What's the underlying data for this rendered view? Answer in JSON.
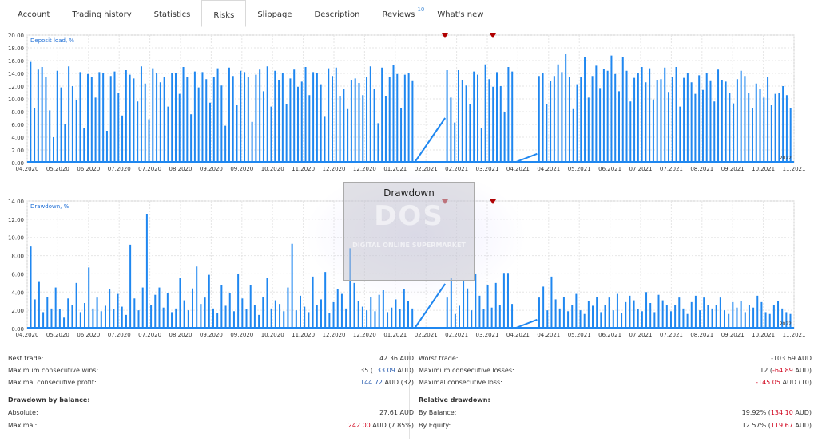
{
  "tabs": [
    {
      "label": "Account",
      "active": false
    },
    {
      "label": "Trading history",
      "active": false
    },
    {
      "label": "Statistics",
      "active": false
    },
    {
      "label": "Risks",
      "active": true
    },
    {
      "label": "Slippage",
      "active": false
    },
    {
      "label": "Description",
      "active": false
    },
    {
      "label": "Reviews",
      "badge": "10",
      "active": false
    },
    {
      "label": "What's new",
      "active": false
    }
  ],
  "x_tick_labels": [
    "04.2020",
    "05.2020",
    "06.2020",
    "07.2020",
    "07.2020",
    "08.2020",
    "09.2020",
    "09.2020",
    "10.2020",
    "11.2020",
    "12.2020",
    "12.2020",
    "01.2021",
    "02.2021",
    "02.2021",
    "03.2021",
    "04.2021",
    "04.2021",
    "05.2021",
    "06.2021",
    "07.2021",
    "07.2021",
    "08.2021",
    "09.2021",
    "10.2021",
    "11.2021"
  ],
  "chart_data": [
    {
      "type": "area",
      "title": "Deposit load, %",
      "ylabel": "",
      "xlabel": "",
      "ylim": [
        0,
        20
      ],
      "y_ticks": [
        "0.00",
        "2.00",
        "4.00",
        "6.00",
        "8.00",
        "10.00",
        "12.00",
        "14.00",
        "16.00",
        "18.00",
        "20.00"
      ],
      "corner_label": "2022",
      "grid": true,
      "color": "#1f87f0",
      "peaks": [
        15.8,
        8.5,
        14.6,
        15.0,
        13.5,
        8.2,
        4.0,
        14.4,
        11.8,
        6.0,
        15.1,
        12.0,
        9.8,
        14.2,
        5.5,
        13.9,
        13.4,
        10.2,
        14.2,
        14.0,
        5.0,
        13.6,
        14.3,
        11.0,
        7.4,
        14.5,
        13.8,
        13.2,
        9.6,
        15.1,
        12.4,
        6.8,
        14.8,
        14.0,
        12.6,
        13.4,
        8.8,
        14.0,
        14.1,
        10.8,
        15.0,
        13.5,
        7.6,
        14.3,
        11.8,
        14.2,
        13.1,
        9.4,
        13.5,
        14.8,
        12.1,
        5.8,
        14.9,
        13.6,
        9.0,
        14.4,
        14.2,
        13.4,
        6.4,
        13.8,
        14.6,
        11.2,
        15.1,
        8.8,
        14.4,
        13.0,
        14.0,
        9.2,
        13.2,
        14.6,
        11.9,
        12.7,
        15.0,
        10.6,
        14.2,
        14.1,
        12.3,
        7.2,
        14.8,
        13.6,
        14.9,
        10.5,
        11.5,
        8.4,
        13.0,
        13.2,
        12.5,
        10.6,
        13.5,
        15.1,
        11.5,
        6.2,
        14.9,
        10.4,
        13.4,
        15.3,
        13.9,
        8.6,
        13.8,
        14.0,
        12.9,
        14.5,
        10.2,
        6.3,
        14.5,
        13.0,
        12.1,
        9.2,
        14.3,
        13.8,
        5.4,
        15.4,
        13.1,
        11.9,
        14.2,
        12.0,
        7.9,
        15.0,
        14.3,
        13.6,
        14.1,
        9.2,
        12.8,
        13.6,
        15.4,
        14.2,
        17.0,
        13.4,
        8.4,
        12.3,
        13.5,
        16.6,
        10.2,
        13.6,
        15.2,
        11.7,
        14.7,
        14.4,
        16.8,
        13.9,
        11.2,
        16.6,
        14.4,
        9.6,
        13.3,
        14.0,
        15.0,
        12.6,
        14.8,
        9.9,
        13.0,
        13.1,
        14.9,
        11.1,
        13.5,
        15.0,
        8.8,
        13.3,
        14.0,
        12.6,
        10.8,
        13.7,
        11.4,
        14.0,
        12.9,
        9.6,
        14.6,
        13.0,
        12.7,
        11.0,
        9.3,
        13.1,
        14.4,
        13.6,
        11.0,
        8.5,
        12.4,
        11.6,
        10.2,
        13.5,
        9.0,
        10.8,
        11.0,
        12.0,
        10.6,
        8.6
      ]
    },
    {
      "type": "area",
      "title": "Drawdown, %",
      "ylabel": "",
      "xlabel": "",
      "ylim": [
        0,
        14
      ],
      "y_ticks": [
        "0.00",
        "2.00",
        "4.00",
        "6.00",
        "8.00",
        "10.00",
        "12.00",
        "14.00"
      ],
      "corner_label": "2022",
      "grid": true,
      "color": "#1f87f0",
      "peaks": [
        9.0,
        3.2,
        5.2,
        1.8,
        3.5,
        2.2,
        4.5,
        2.1,
        1.2,
        3.3,
        2.6,
        5.0,
        1.8,
        2.8,
        6.7,
        2.2,
        3.4,
        1.9,
        2.5,
        4.3,
        2.1,
        3.8,
        2.4,
        1.5,
        9.2,
        3.3,
        2.0,
        4.5,
        12.6,
        2.6,
        3.7,
        4.5,
        2.3,
        3.9,
        1.8,
        2.2,
        5.6,
        3.1,
        2.0,
        4.4,
        6.8,
        2.7,
        3.4,
        5.9,
        2.2,
        1.7,
        4.8,
        2.5,
        3.9,
        1.9,
        6.0,
        3.3,
        2.1,
        4.8,
        2.6,
        1.5,
        3.5,
        5.6,
        2.2,
        3.1,
        2.7,
        1.9,
        4.5,
        9.3,
        2.0,
        3.6,
        2.4,
        1.8,
        5.7,
        2.6,
        3.2,
        6.2,
        1.7,
        2.9,
        4.3,
        3.8,
        2.2,
        8.8,
        5.0,
        3.0,
        2.4,
        2.0,
        3.5,
        1.9,
        3.7,
        4.2,
        1.8,
        2.3,
        3.2,
        2.1,
        4.3,
        3.0,
        2.2,
        3.4,
        5.6,
        1.6,
        2.5,
        5.3,
        4.4,
        2.0,
        6.0,
        3.6,
        2.1,
        4.8,
        2.3,
        5.0,
        2.6,
        6.1,
        6.1,
        2.7,
        3.4,
        4.6,
        2.0,
        5.7,
        3.2,
        2.2,
        3.5,
        1.9,
        2.6,
        3.8,
        2.0,
        1.6,
        3.0,
        2.5,
        3.5,
        1.8,
        2.6,
        3.4,
        2.0,
        3.8,
        1.7,
        2.9,
        3.6,
        3.1,
        2.1,
        1.9,
        4.0,
        2.8,
        1.8,
        3.7,
        3.1,
        2.6,
        1.9,
        2.6,
        3.4,
        2.2,
        1.6,
        2.9,
        3.6,
        2.0,
        3.4,
        2.6,
        2.2,
        2.6,
        3.4,
        2.0,
        1.6,
        2.9,
        2.3,
        3.0,
        1.8,
        2.6,
        2.3,
        3.6,
        2.9,
        1.8,
        1.6,
        2.6,
        3.0,
        2.2,
        1.8,
        1.6
      ]
    }
  ],
  "watermark": {
    "title": "Drawdown",
    "logo": "DOS",
    "subtitle": "DIGITAL ONLINE SUPERMARKET"
  },
  "stats": {
    "left": [
      {
        "label": "Best trade:",
        "value": "42.36 AUD",
        "style": "blue"
      },
      {
        "label": "Maximum consecutive wins:",
        "value_a": "35 (",
        "value_b": "133.09",
        "value_c": " AUD)"
      },
      {
        "label": "Maximal consecutive profit:",
        "value_a": "144.72",
        "value_c": " AUD (32)"
      },
      {
        "heading": "Drawdown by balance:"
      },
      {
        "label": "Absolute:",
        "value": "27.61 AUD",
        "style": "red"
      },
      {
        "label": "Maximal:",
        "value_a": "242.00",
        "value_c": " AUD (7.85%)"
      }
    ],
    "right": [
      {
        "label": "Worst trade:",
        "value": "-103.69 AUD",
        "style": "red"
      },
      {
        "label": "Maximum consecutive losses:",
        "value_a": "12 (",
        "value_b": "-64.89",
        "value_c": " AUD)"
      },
      {
        "label": "Maximal consecutive loss:",
        "value_a": "-145.05",
        "value_c": " AUD (10)"
      },
      {
        "heading": "Relative drawdown:"
      },
      {
        "label": "By Balance:",
        "value_a": "19.92% (",
        "value_b": "134.10",
        "value_c": " AUD)"
      },
      {
        "label": "By Equity:",
        "value_a": "12.57% (",
        "value_b": "119.67",
        "value_c": " AUD)"
      }
    ]
  }
}
